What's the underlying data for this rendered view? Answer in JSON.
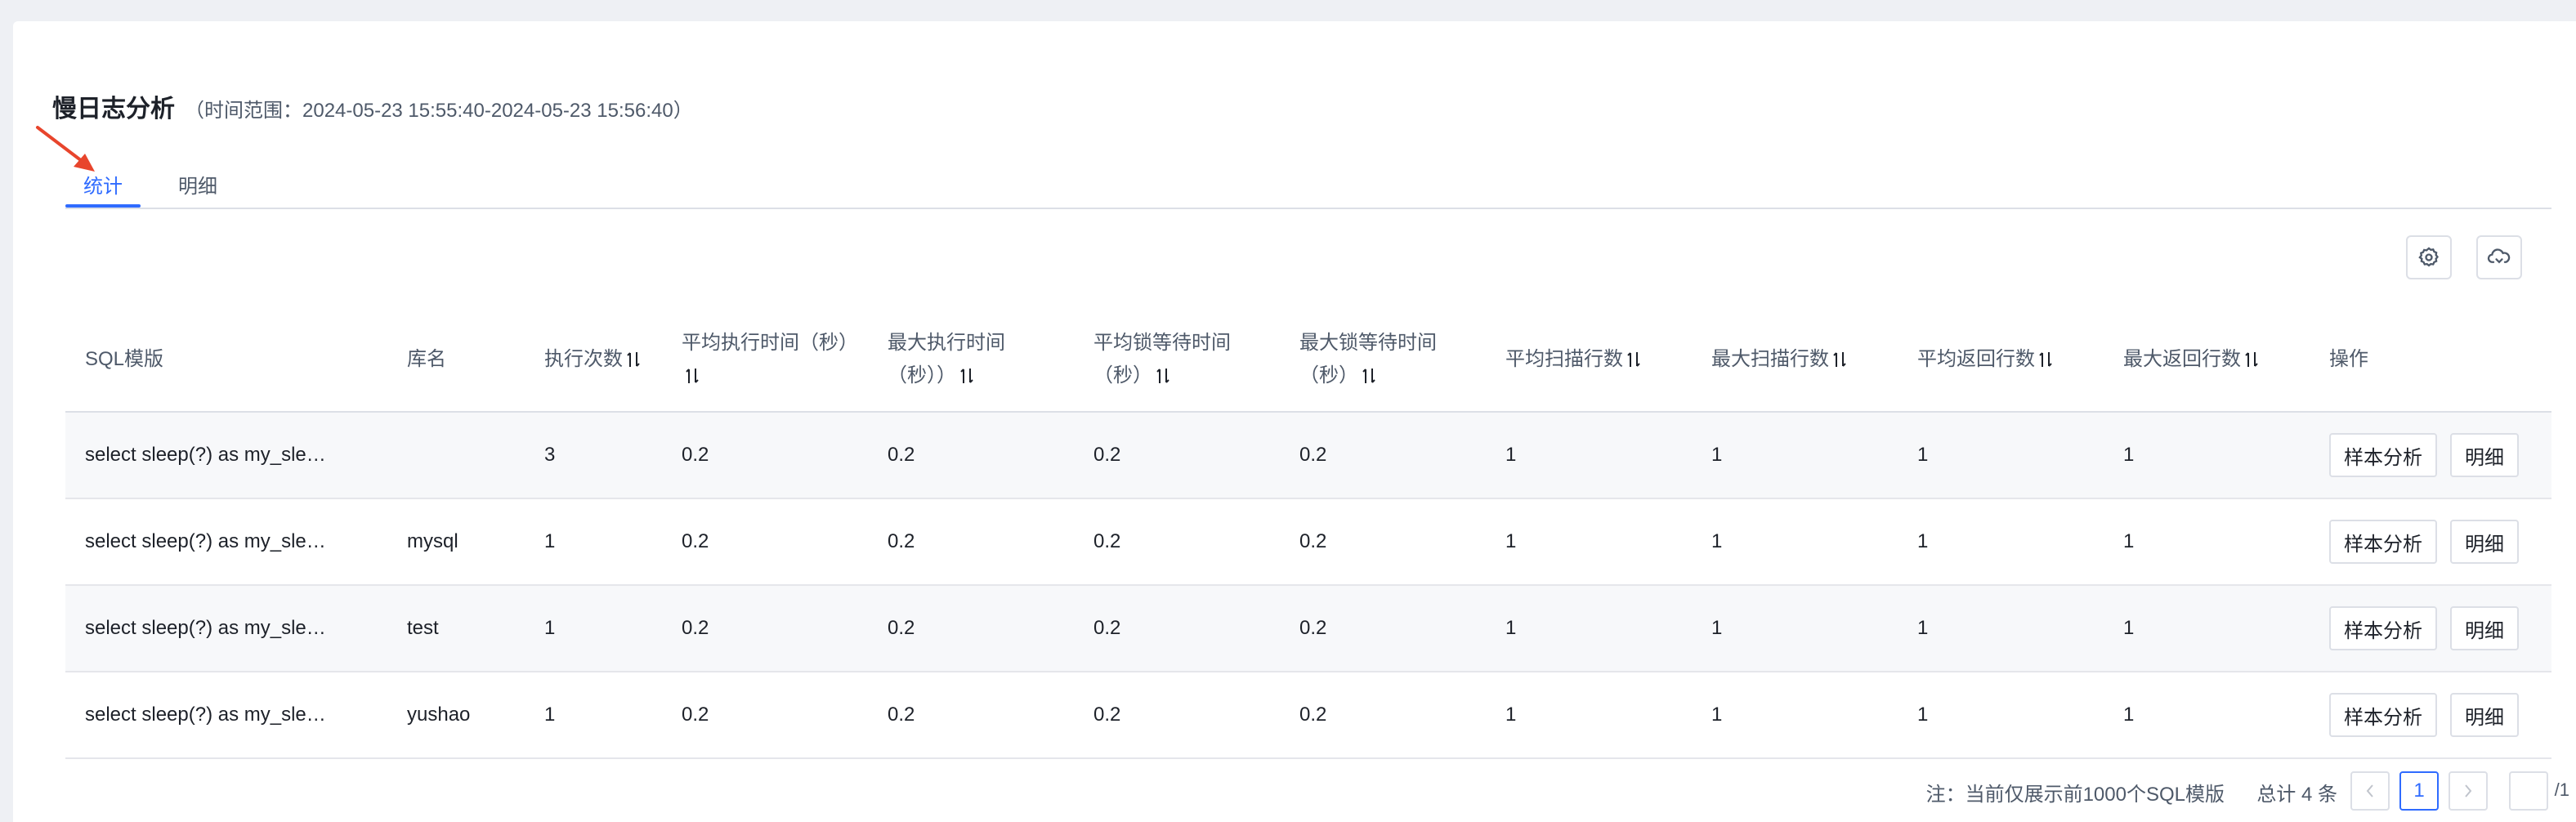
{
  "header": {
    "title": "慢日志分析",
    "time_range": "（时间范围：2024-05-23 15:55:40-2024-05-23 15:56:40）"
  },
  "tabs": [
    {
      "label": "统计",
      "active": true
    },
    {
      "label": "明细",
      "active": false
    }
  ],
  "toolbar": {
    "settings_icon": "gear-icon",
    "export_icon": "cloud-refresh-icon"
  },
  "table": {
    "columns": {
      "sql_template": "SQL模版",
      "db_name": "库名",
      "exec_count": "执行次数",
      "avg_exec_time": "平均执行时间（秒）",
      "max_exec_time": "最大执行时间（秒））",
      "avg_lock_wait": "平均锁等待时间（秒）",
      "max_lock_wait": "最大锁等待时间（秒）",
      "avg_scan_rows": "平均扫描行数",
      "max_scan_rows": "最大扫描行数",
      "avg_return_rows": "平均返回行数",
      "max_return_rows": "最大返回行数",
      "actions": "操作"
    },
    "rows": [
      {
        "sql": "select sleep(?) as my_sle…",
        "db": "",
        "count": "3",
        "avg_exec": "0.2",
        "max_exec": "0.2",
        "avg_lock": "0.2",
        "max_lock": "0.2",
        "avg_scan": "1",
        "max_scan": "1",
        "avg_ret": "1",
        "max_ret": "1"
      },
      {
        "sql": "select sleep(?) as my_sle…",
        "db": "mysql",
        "count": "1",
        "avg_exec": "0.2",
        "max_exec": "0.2",
        "avg_lock": "0.2",
        "max_lock": "0.2",
        "avg_scan": "1",
        "max_scan": "1",
        "avg_ret": "1",
        "max_ret": "1"
      },
      {
        "sql": "select sleep(?) as my_sle…",
        "db": "test",
        "count": "1",
        "avg_exec": "0.2",
        "max_exec": "0.2",
        "avg_lock": "0.2",
        "max_lock": "0.2",
        "avg_scan": "1",
        "max_scan": "1",
        "avg_ret": "1",
        "max_ret": "1"
      },
      {
        "sql": "select sleep(?) as my_sle…",
        "db": "yushao",
        "count": "1",
        "avg_exec": "0.2",
        "max_exec": "0.2",
        "avg_lock": "0.2",
        "max_lock": "0.2",
        "avg_scan": "1",
        "max_scan": "1",
        "avg_ret": "1",
        "max_ret": "1"
      }
    ],
    "action_labels": {
      "sample": "样本分析",
      "detail": "明细"
    }
  },
  "footer": {
    "note": "注：当前仅展示前1000个SQL模版",
    "total": "总计 4 条",
    "current_page": "1",
    "page_total": "/1",
    "prev_icon": "chevron-left-icon",
    "next_icon": "chevron-right-icon"
  },
  "colors": {
    "accent": "#2f6bff",
    "annotation_arrow": "#e8452c"
  }
}
